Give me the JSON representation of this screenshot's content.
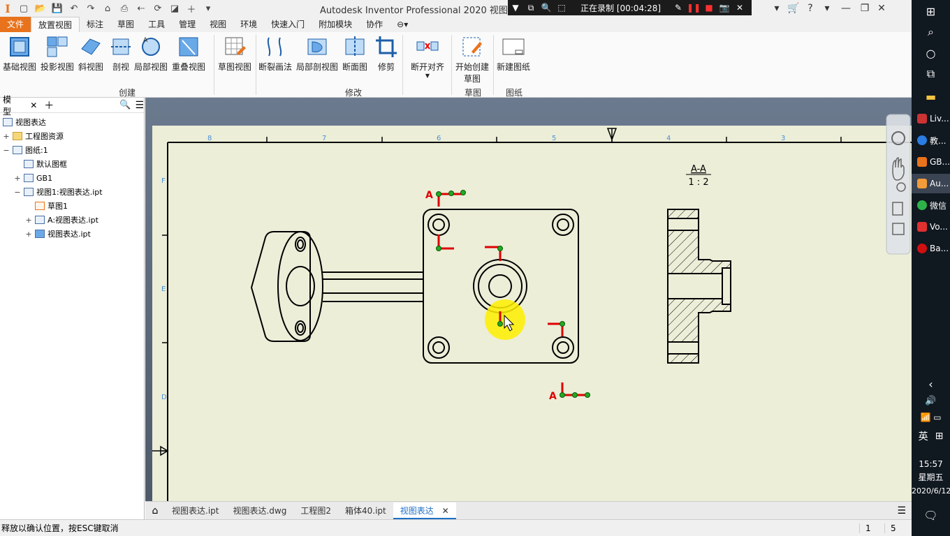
{
  "titlebar": {
    "app_logo": "I",
    "title": "Autodesk Inventor Professional 2020   视图表",
    "recording": {
      "label": "正在录制 [00:04:28]"
    }
  },
  "ribbon_tabs": [
    "文件",
    "放置视图",
    "标注",
    "草图",
    "工具",
    "管理",
    "视图",
    "环境",
    "快速入门",
    "附加模块",
    "协作"
  ],
  "ribbon": {
    "buttons": [
      {
        "label": "基础视图",
        "icon": "base-view-icon"
      },
      {
        "label": "投影视图",
        "icon": "projected-view-icon"
      },
      {
        "label": "斜视图",
        "icon": "auxiliary-view-icon"
      },
      {
        "label": "剖视",
        "icon": "section-view-icon"
      },
      {
        "label": "局部视图",
        "icon": "detail-view-icon"
      },
      {
        "label": "重叠视图",
        "icon": "overlay-view-icon"
      },
      {
        "label": "草图视图",
        "icon": "sketch-view-icon"
      },
      {
        "label": "断裂画法",
        "icon": "break-icon"
      },
      {
        "label": "局部剖视图",
        "icon": "break-out-icon"
      },
      {
        "label": "断面图",
        "icon": "slice-icon"
      },
      {
        "label": "修剪",
        "icon": "crop-icon"
      },
      {
        "label": "断开对齐",
        "icon": "break-alignment-icon"
      },
      {
        "label": "开始创建",
        "label2": "草图",
        "icon": "start-sketch-icon"
      },
      {
        "label": "新建图纸",
        "icon": "new-sheet-icon"
      }
    ],
    "groups": [
      "创建",
      "修改",
      "草图",
      "图纸"
    ]
  },
  "browser": {
    "tab_label": "模型",
    "items": [
      {
        "label": "视图表达"
      },
      {
        "label": "工程图资源"
      },
      {
        "label": "图纸:1"
      },
      {
        "label": "默认图框"
      },
      {
        "label": "GB1"
      },
      {
        "label": "视图1:视图表达.ipt"
      },
      {
        "label": "草图1"
      },
      {
        "label": "A:视图表达.ipt"
      },
      {
        "label": "视图表达.ipt"
      }
    ]
  },
  "drawing": {
    "section_title": "A-A",
    "section_scale": "1 : 2",
    "section_label": "A",
    "zone_numbers": [
      "8",
      "7",
      "6",
      "5",
      "4",
      "3"
    ],
    "zone_letters": [
      "F",
      "E",
      "D"
    ],
    "colors": {
      "sheet": "#eceed8",
      "cut_line": "#e00000",
      "grip": "#22aa22",
      "cursor_highlight": "#ffee00"
    }
  },
  "doc_tabs": [
    "视图表达.ipt",
    "视图表达.dwg",
    "工程图2",
    "箱体40.ipt",
    "视图表达"
  ],
  "status": {
    "message": "释放以确认位置，按ESC键取消",
    "count1": "1",
    "count2": "5"
  },
  "taskbar": {
    "apps": [
      "Liv...",
      "教...",
      "GB...",
      "Au...",
      "微信",
      "Vo...",
      "Ba..."
    ],
    "lang": "英",
    "time": "15:57",
    "weekday": "星期五",
    "date": "2020/6/12"
  }
}
